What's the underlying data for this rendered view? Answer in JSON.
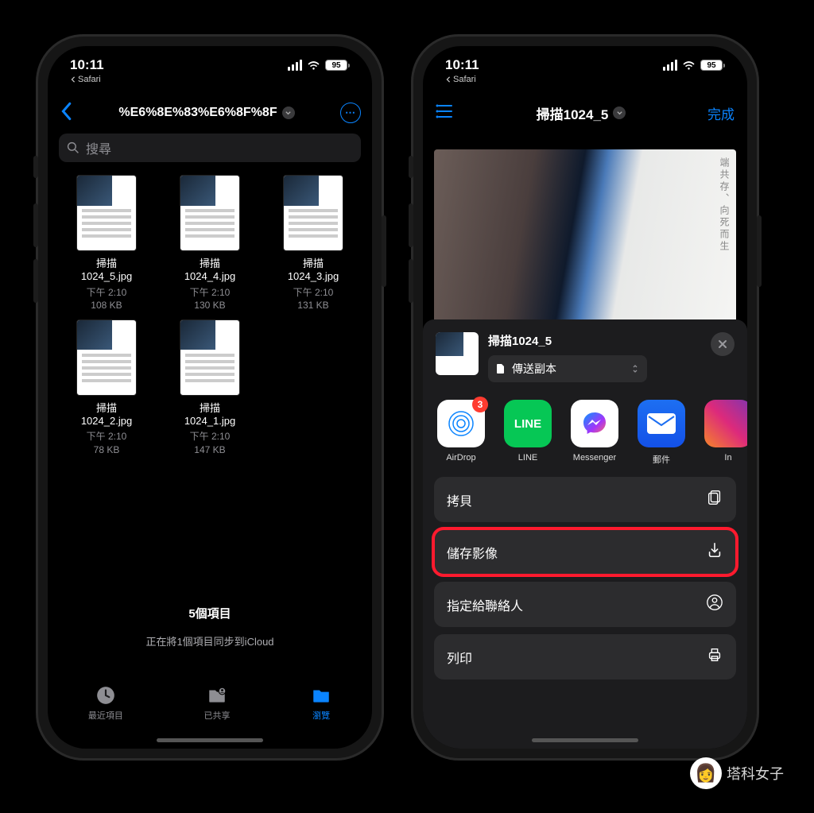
{
  "status": {
    "time": "10:11",
    "breadcrumb": "Safari",
    "battery": "95"
  },
  "left_phone": {
    "nav_title": "%E6%8E%83%E6%8F%8F",
    "search_placeholder": "搜尋",
    "files": [
      {
        "name_l1": "掃描",
        "name_l2": "1024_5.jpg",
        "time": "下午 2:10",
        "size": "108 KB"
      },
      {
        "name_l1": "掃描",
        "name_l2": "1024_4.jpg",
        "time": "下午 2:10",
        "size": "130 KB"
      },
      {
        "name_l1": "掃描",
        "name_l2": "1024_3.jpg",
        "time": "下午 2:10",
        "size": "131 KB"
      },
      {
        "name_l1": "掃描",
        "name_l2": "1024_2.jpg",
        "time": "下午 2:10",
        "size": "78 KB"
      },
      {
        "name_l1": "掃描",
        "name_l2": "1024_1.jpg",
        "time": "下午 2:10",
        "size": "147 KB"
      }
    ],
    "count": "5個項目",
    "sync_status": "正在將1個項目同步到iCloud",
    "tabs": [
      {
        "label": "最近項目"
      },
      {
        "label": "已共享"
      },
      {
        "label": "瀏覽"
      }
    ]
  },
  "right_phone": {
    "nav_title": "掃描1024_5",
    "done": "完成",
    "preview_text": "端共存、向死而生",
    "sheet": {
      "title": "掃描1024_5",
      "option": "傳送副本",
      "apps": [
        {
          "label": "AirDrop",
          "badge": "3"
        },
        {
          "label": "LINE"
        },
        {
          "label": "Messenger"
        },
        {
          "label": "郵件"
        },
        {
          "label": "In"
        }
      ],
      "actions": [
        {
          "label": "拷貝"
        },
        {
          "label": "儲存影像"
        },
        {
          "label": "指定給聯絡人"
        },
        {
          "label": "列印"
        }
      ]
    }
  },
  "watermark": "塔科女子"
}
